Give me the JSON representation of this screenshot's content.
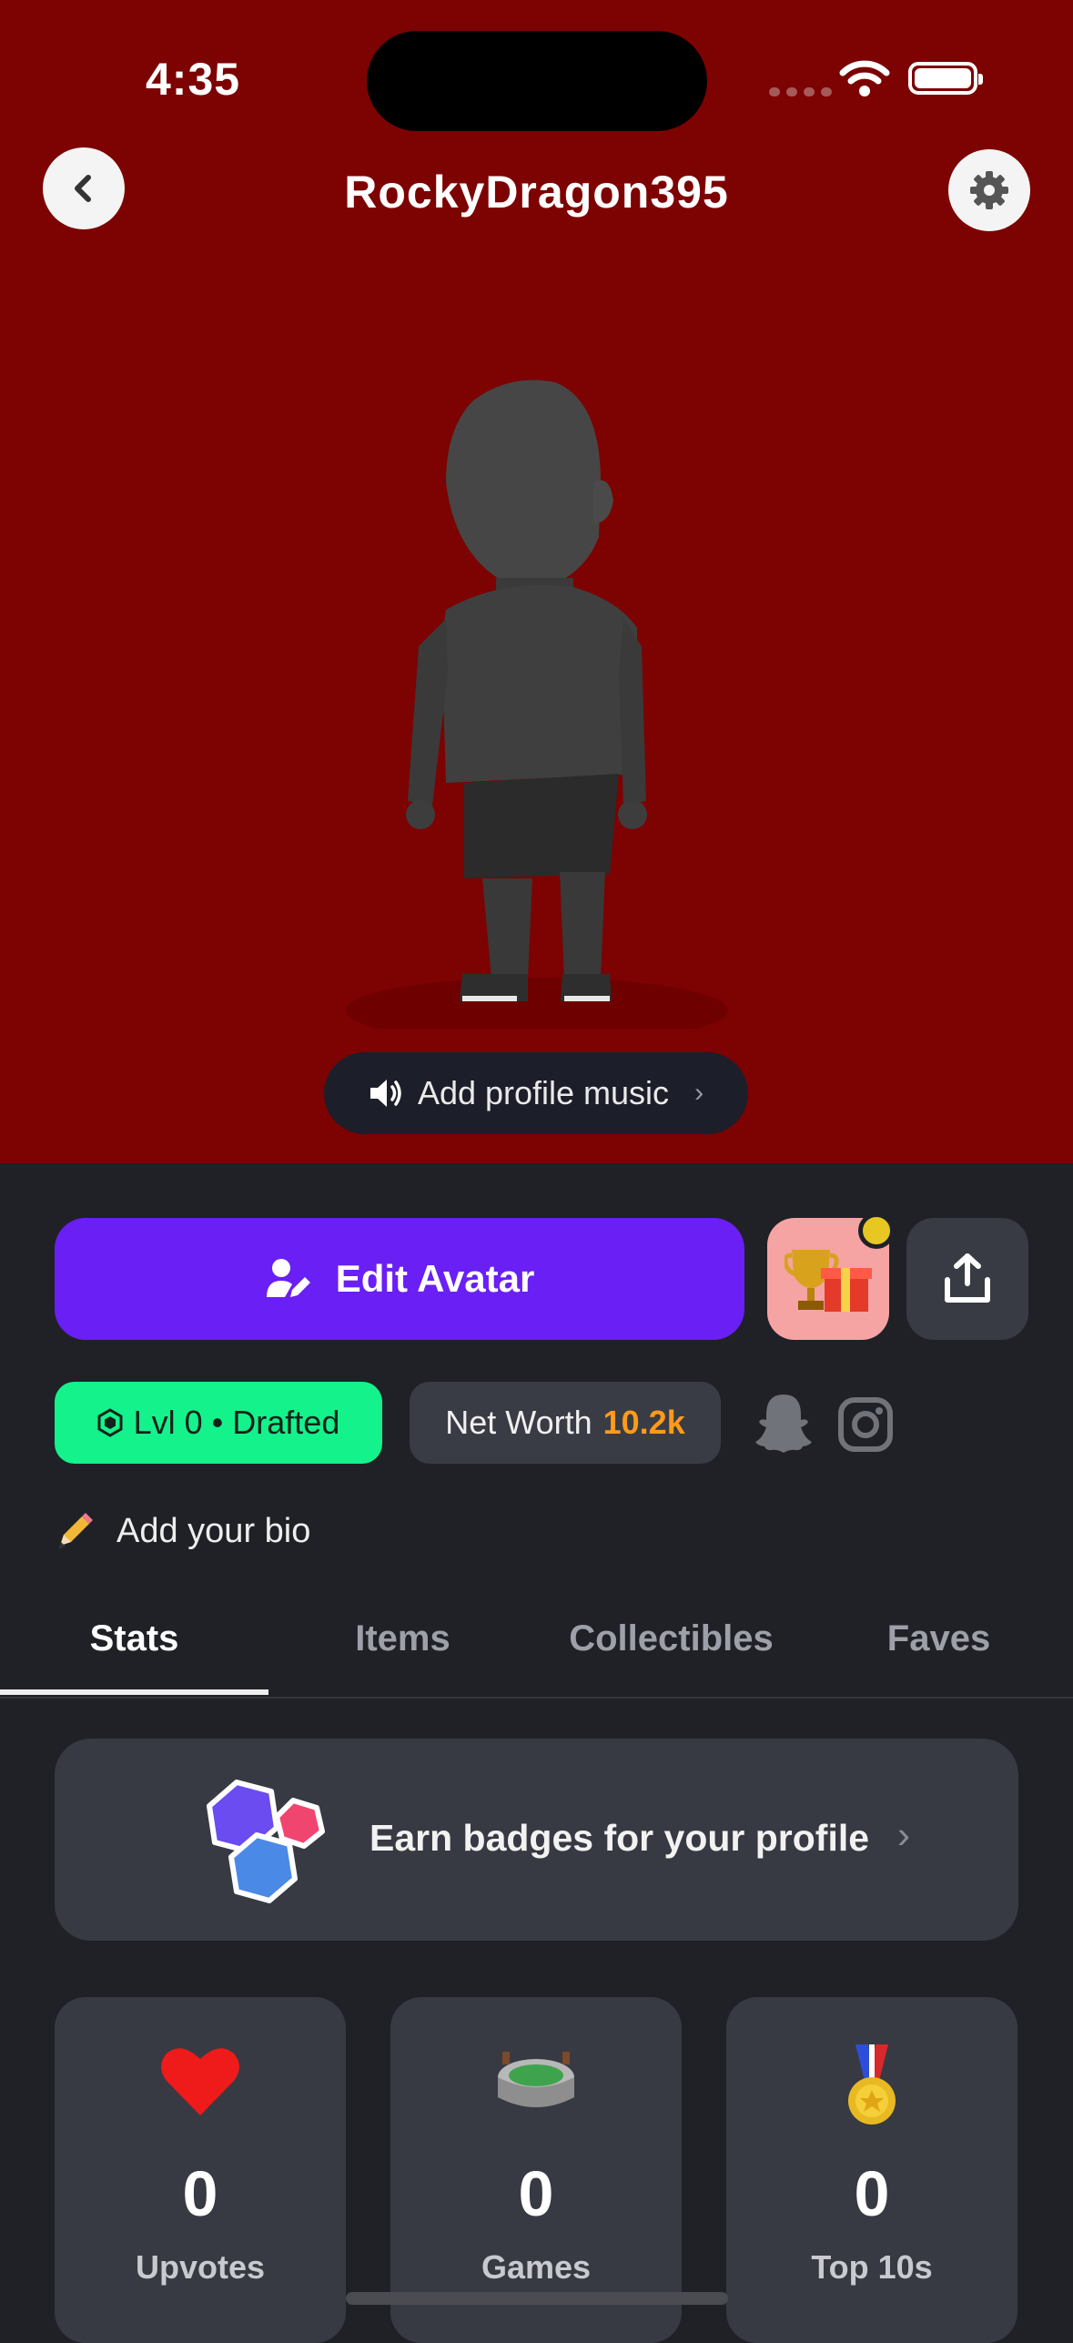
{
  "status_bar": {
    "time": "4:35"
  },
  "header": {
    "username": "RockyDragon395",
    "back_icon": "chevron-left-icon",
    "settings_icon": "gear-icon"
  },
  "colors": {
    "hero_background": "#7d0202",
    "page_background": "#1f2126",
    "primary_button": "#6a1ff4",
    "level_pill": "#14f28b",
    "net_worth_accent": "#ff9a1a"
  },
  "music": {
    "label": "Add profile music",
    "icon": "speaker-icon"
  },
  "actions": {
    "edit_avatar_label": "Edit Avatar",
    "gift_icon": "trophy-gift-icon",
    "share_icon": "share-icon"
  },
  "level": {
    "label": "Lvl 0 • Drafted"
  },
  "net_worth": {
    "label": "Net Worth",
    "value": "10.2k"
  },
  "socials": [
    "snapchat-icon",
    "instagram-icon"
  ],
  "bio": {
    "placeholder": "Add your bio",
    "icon": "pencil-icon"
  },
  "tabs": [
    {
      "label": "Stats",
      "active": true
    },
    {
      "label": "Items",
      "active": false
    },
    {
      "label": "Collectibles",
      "active": false
    },
    {
      "label": "Faves",
      "active": false
    }
  ],
  "badges_card": {
    "label": "Earn badges for your profile",
    "icon": "badges-icon"
  },
  "stats": [
    {
      "icon": "heart-icon",
      "value": "0",
      "label": "Upvotes"
    },
    {
      "icon": "stadium-icon",
      "value": "0",
      "label": "Games"
    },
    {
      "icon": "medal-icon",
      "value": "0",
      "label": "Top 10s"
    }
  ]
}
